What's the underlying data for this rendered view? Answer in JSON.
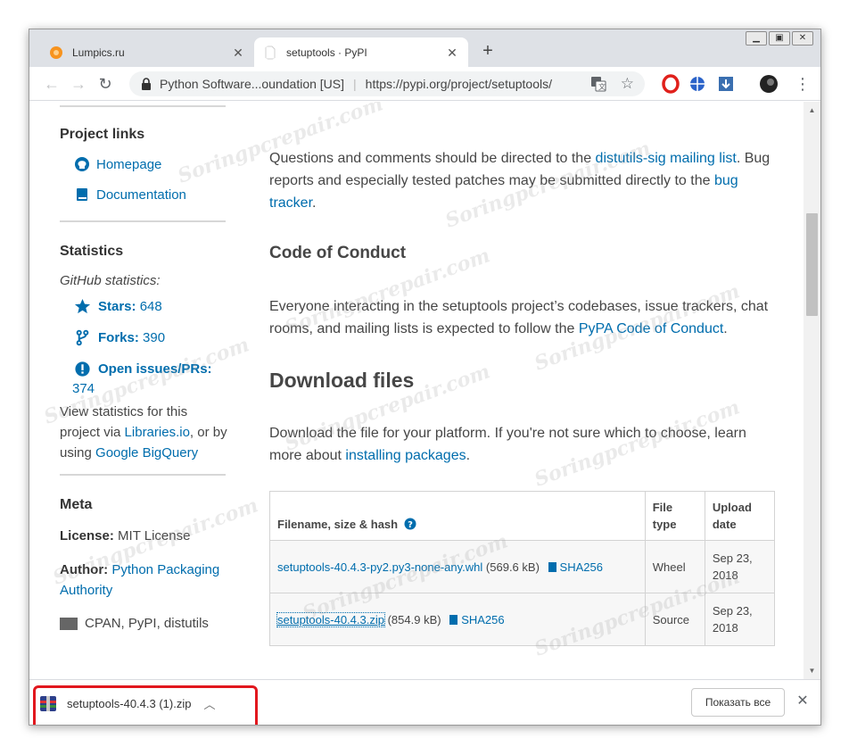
{
  "browser": {
    "tabs": [
      {
        "title": "Lumpics.ru",
        "active": false,
        "favicon": "orange-circle-icon"
      },
      {
        "title": "setuptools · PyPI",
        "active": true,
        "favicon": "blank-page-icon"
      }
    ],
    "window_buttons": [
      "▁",
      "▣",
      "✕"
    ],
    "omnibox": {
      "site_identity": "Python Software...oundation [US]",
      "url": "https://pypi.org/project/setuptools/"
    }
  },
  "sidebar": {
    "project_links_title": "Project links",
    "project_links": [
      {
        "label": "Homepage",
        "icon": "github-icon"
      },
      {
        "label": "Documentation",
        "icon": "book-icon"
      }
    ],
    "statistics_title": "Statistics",
    "github_statistics_label": "GitHub statistics:",
    "stats": [
      {
        "label": "Stars:",
        "value": "648",
        "icon": "star-icon"
      },
      {
        "label": "Forks:",
        "value": "390",
        "icon": "fork-icon"
      },
      {
        "label": "Open issues/PRs:",
        "value": "374",
        "icon": "exclamation-icon"
      }
    ],
    "view_stats_pre": "View statistics for this project via ",
    "libraries_link": "Libraries.io",
    "view_stats_mid": ", or by using ",
    "bigquery_link": "Google BigQuery",
    "meta_title": "Meta",
    "license_label": "License:",
    "license_value": "MIT License",
    "author_label": "Author:",
    "author_value": "Python Packaging Authority",
    "requires_partial": "CPAN, PyPI, distutils"
  },
  "main": {
    "intro_pre": "Questions and comments should be directed to the ",
    "intro_link1": "distutils-sig mailing list",
    "intro_mid": ". Bug reports and especially tested patches may be submitted directly to the ",
    "intro_link2": "bug tracker",
    "intro_end": ".",
    "coc_heading": "Code of Conduct",
    "coc_pre": "Everyone interacting in the setuptools project’s codebases, issue trackers, chat rooms, and mailing lists is expected to follow the ",
    "coc_link": "PyPA Code of Conduct",
    "coc_end": ".",
    "download_heading": "Download files",
    "download_pre": "Download the file for your platform. If you're not sure which to choose, learn more about ",
    "download_link": "installing packages",
    "download_end": ".",
    "table": {
      "headers": [
        "Filename, size & hash",
        "File type",
        "Upload date"
      ],
      "rows": [
        {
          "filename": "setuptools-40.4.3-py2.py3-none-any.whl",
          "size": "(569.6 kB)",
          "hash": "SHA256",
          "type": "Wheel",
          "date": "Sep 23, 2018"
        },
        {
          "filename": "setuptools-40.4.3.zip",
          "size": "(854.9 kB)",
          "hash": "SHA256",
          "type": "Source",
          "date": "Sep 23, 2018"
        }
      ]
    }
  },
  "download_bar": {
    "filename": "setuptools-40.4.3 (1).zip",
    "show_all": "Показать все"
  },
  "watermark_text": "Soringpcrepair.com",
  "colors": {
    "link": "#006dad",
    "highlight": "#e1171e"
  }
}
